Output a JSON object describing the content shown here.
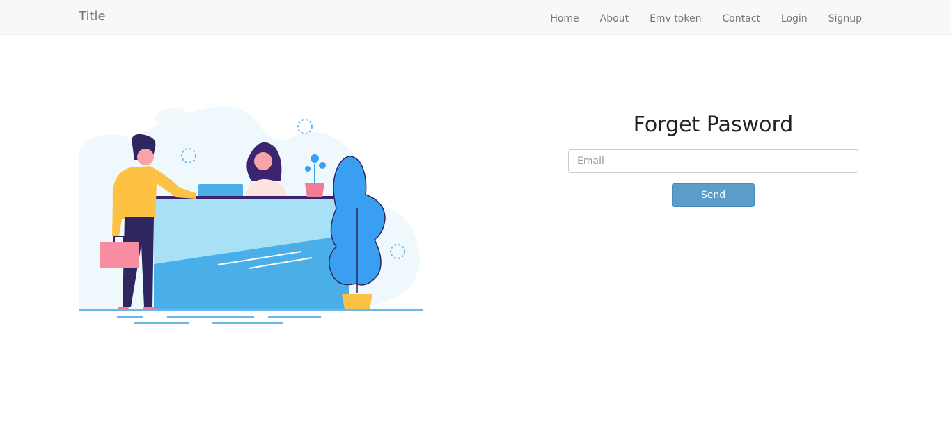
{
  "navbar": {
    "brand": "Title",
    "items": [
      {
        "label": "Home"
      },
      {
        "label": "About"
      },
      {
        "label": "Emv token"
      },
      {
        "label": "Contact"
      },
      {
        "label": "Login"
      },
      {
        "label": "Signup"
      }
    ]
  },
  "form": {
    "title": "Forget Pasword",
    "email_placeholder": "Email",
    "email_value": "",
    "submit_label": "Send"
  },
  "colors": {
    "navbar_bg": "#f8f8f8",
    "button": "#5b9cc8",
    "desk": "#4aaee8",
    "plant": "#3a9ff0"
  }
}
